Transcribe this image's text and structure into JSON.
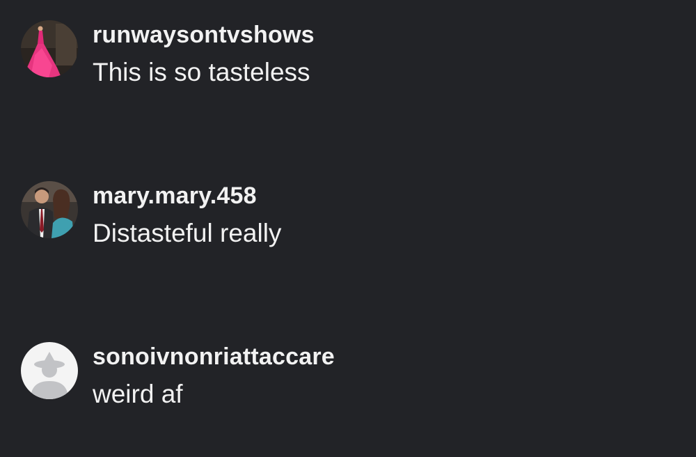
{
  "comments": [
    {
      "username": "runwaysontvshows",
      "text": "This is so tasteless",
      "avatar_icon": "profile-photo-pink-gown"
    },
    {
      "username": "mary.mary.458",
      "text": "Distasteful really",
      "avatar_icon": "profile-photo-couple"
    },
    {
      "username": "sonoivnonriattaccare",
      "text": "weird af",
      "avatar_icon": "default-avatar-icon"
    }
  ],
  "colors": {
    "background": "#222327",
    "text": "#f2f2f2",
    "default_avatar_bg": "#f4f4f4",
    "default_avatar_fg": "#c2c3c6"
  }
}
